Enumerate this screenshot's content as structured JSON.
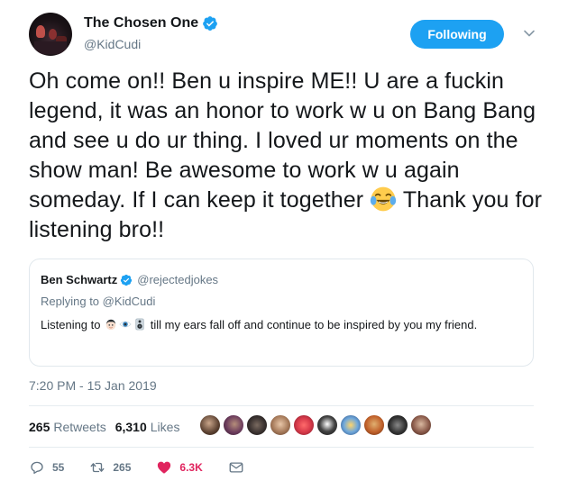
{
  "author": {
    "display_name": "The Chosen One",
    "handle": "@KidCudi",
    "verified": true,
    "follow_button_label": "Following"
  },
  "tweet": {
    "text_before_emoji": "Oh come on!! Ben u inspire ME!!  U are a fuckin legend, it was an honor to work w u on Bang Bang and see u do ur thing.  I loved ur moments on the show man!  Be awesome to work w u again someday.  If I can keep it together ",
    "emoji": "face-with-tears-of-joy",
    "text_after_emoji": " Thank you for listening bro!!"
  },
  "quoted_tweet": {
    "display_name": "Ben Schwartz",
    "handle": "@rejectedjokes",
    "verified": true,
    "replying_prefix": "Replying to ",
    "replying_handle": "@KidCudi",
    "text_before_emoji": "Listening to ",
    "emojis": [
      "man-face-emoji",
      "eye-emoji",
      "speaker-emoji"
    ],
    "text_after_emoji": " till my ears fall off and continue to be inspired by you my friend."
  },
  "timestamp": "7:20 PM - 15 Jan 2019",
  "stats": {
    "retweets_count": "265",
    "retweets_label": "Retweets",
    "likes_count": "6,310",
    "likes_label": "Likes"
  },
  "likers_count_shown": 10,
  "actions": {
    "reply_count": "55",
    "retweet_count": "265",
    "like_count": "6.3K"
  },
  "colors": {
    "brand_blue": "#1da1f2",
    "like_red": "#e0245e",
    "secondary_text": "#657786"
  }
}
